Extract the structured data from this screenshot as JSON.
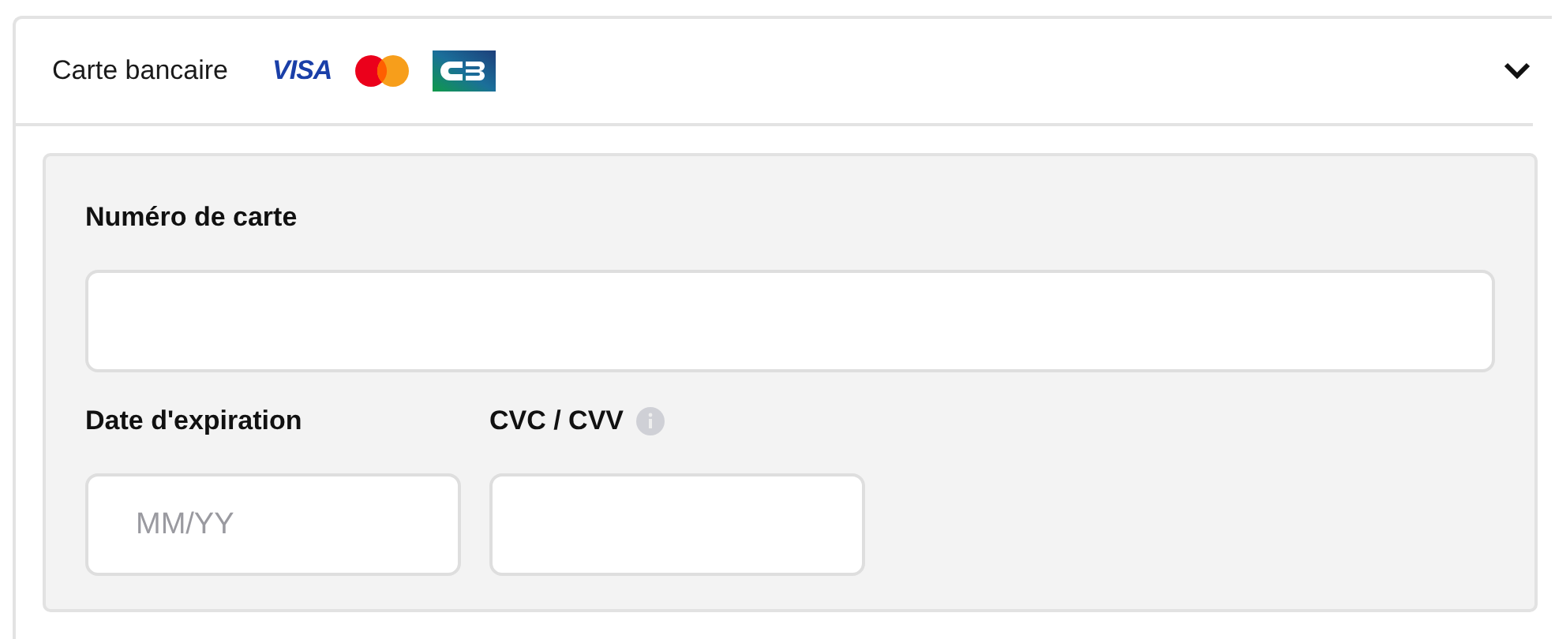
{
  "payment_method": {
    "title": "Carte bancaire",
    "expanded": true,
    "brands": [
      {
        "kind": "visa",
        "label": "VISA"
      },
      {
        "kind": "mastercard"
      },
      {
        "kind": "cb"
      }
    ],
    "fields": [
      {
        "label": "Numéro de carte",
        "kind": "wide"
      },
      {
        "label": "Date d'expiration",
        "placeholder": "MM/YY",
        "kind": "narrow"
      },
      {
        "label": "CVC / CVV",
        "info": true,
        "kind": "narrow"
      }
    ]
  }
}
